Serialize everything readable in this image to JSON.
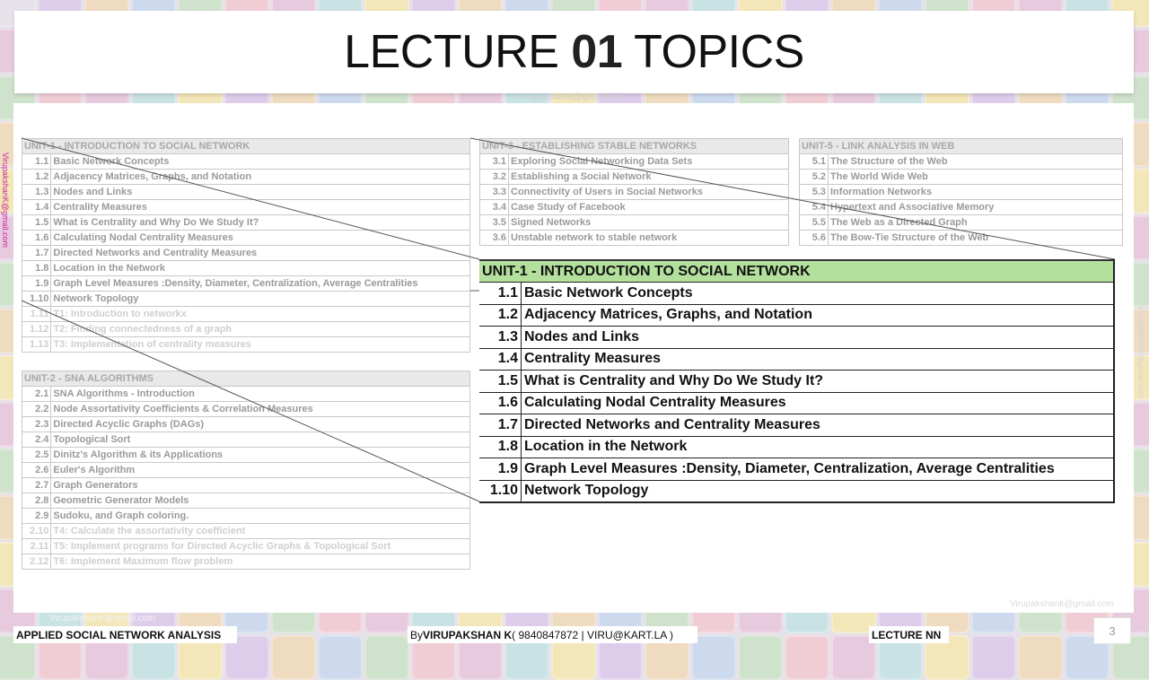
{
  "slide": {
    "title_prefix": "LECTURE ",
    "title_number": "01",
    "title_suffix": " TOPICS",
    "watermark": "Virupakshank@gmail.com",
    "side_watermark": "VirupakshanK@gmail.com",
    "page_number": "3"
  },
  "unit1": {
    "heading": "UNIT-1 - INTRODUCTION TO SOCIAL NETWORK",
    "topics": [
      {
        "num": "1.1",
        "title": "Basic Network Concepts"
      },
      {
        "num": "1.2",
        "title": "Adjacency Matrices, Graphs, and Notation"
      },
      {
        "num": "1.3",
        "title": "Nodes and Links"
      },
      {
        "num": "1.4",
        "title": "Centrality Measures"
      },
      {
        "num": "1.5",
        "title": "What is Centrality and Why Do We Study It?"
      },
      {
        "num": "1.6",
        "title": "Calculating Nodal Centrality Measures"
      },
      {
        "num": "1.7",
        "title": "Directed Networks and Centrality Measures"
      },
      {
        "num": "1.8",
        "title": "Location in the Network"
      },
      {
        "num": "1.9",
        "title": "Graph Level Measures :Density, Diameter, Centralization, Average Centralities"
      },
      {
        "num": "1.10",
        "title": "Network Topology"
      }
    ],
    "labs": [
      {
        "num": "1.11",
        "title": "T1: Introduction to networkx"
      },
      {
        "num": "1.12",
        "title": "T2: Finding connectedness of a graph"
      },
      {
        "num": "1.13",
        "title": "T3: Implementation of centrality measures"
      }
    ]
  },
  "unit2": {
    "heading": "UNIT-2 - SNA ALGORITHMS",
    "topics": [
      {
        "num": "2.1",
        "title": "SNA Algorithms - Introduction"
      },
      {
        "num": "2.2",
        "title": "Node Assortativity Coefficients & Correlation Measures"
      },
      {
        "num": "2.3",
        "title": "Directed Acyclic Graphs (DAGs)"
      },
      {
        "num": "2.4",
        "title": "Topological Sort"
      },
      {
        "num": "2.5",
        "title": "Dinitz's Algorithm & its Applications"
      },
      {
        "num": "2.6",
        "title": "Euler's Algorithm"
      },
      {
        "num": "2.7",
        "title": "Graph Generators"
      },
      {
        "num": "2.8",
        "title": "Geometric Generator Models"
      },
      {
        "num": "2.9",
        "title": "Sudoku, and Graph coloring."
      }
    ],
    "labs": [
      {
        "num": "2.10",
        "title": "T4: Calculate the assortativity coefficient"
      },
      {
        "num": "2.11",
        "title": "T5: Implement programs for Directed Acyclic Graphs & Topological Sort"
      },
      {
        "num": "2.12",
        "title": "T6: Implement Maximum flow problem"
      }
    ]
  },
  "unit3": {
    "heading": "UNIT-3 - ESTABLISHING STABLE NETWORKS",
    "topics": [
      {
        "num": "3.1",
        "title": "Exploring Social Networking Data Sets"
      },
      {
        "num": "3.2",
        "title": "Establishing a Social Network"
      },
      {
        "num": "3.3",
        "title": "Connectivity of Users in Social Networks"
      },
      {
        "num": "3.4",
        "title": "Case Study of Facebook"
      },
      {
        "num": "3.5",
        "title": "Signed Networks"
      },
      {
        "num": "3.6",
        "title": "Unstable network to stable network"
      }
    ]
  },
  "unit5": {
    "heading": "UNIT-5 - LINK ANALYSIS IN WEB",
    "topics": [
      {
        "num": "5.1",
        "title": "The Structure of the Web"
      },
      {
        "num": "5.2",
        "title": "The World Wide Web"
      },
      {
        "num": "5.3",
        "title": "Information Networks"
      },
      {
        "num": "5.4",
        "title": "Hypertext and Associative Memory"
      },
      {
        "num": "5.5",
        "title": "The Web as a Directed Graph"
      },
      {
        "num": "5.6",
        "title": "The Bow-Tie Structure of the Web"
      }
    ]
  },
  "footer": {
    "course": "APPLIED SOCIAL NETWORK ANALYSIS",
    "by_label": "By ",
    "author": "VIRUPAKSHAN K",
    "contact": " ( 9840847872 | VIRU@KART.LA )",
    "lecture": "LECTURE NN"
  },
  "colors": {
    "zoom_header": "#b3e19d",
    "side_watermark": "#c7239a"
  }
}
